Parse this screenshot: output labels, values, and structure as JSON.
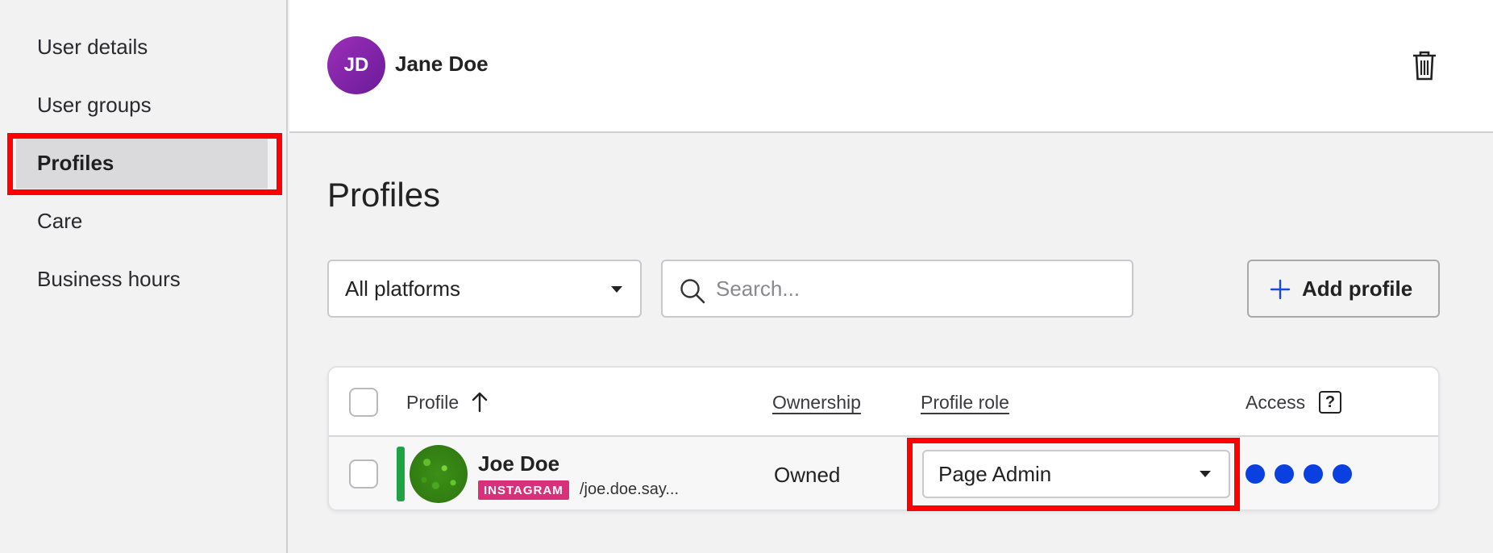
{
  "sidebar": {
    "items": [
      {
        "label": "User details"
      },
      {
        "label": "User groups"
      },
      {
        "label": "Profiles",
        "active": true
      },
      {
        "label": "Care"
      },
      {
        "label": "Business hours"
      }
    ]
  },
  "header": {
    "avatar_initials": "JD",
    "user_name": "Jane Doe",
    "delete_icon": "trash-icon"
  },
  "main": {
    "title": "Profiles",
    "platform_filter": {
      "selected": "All platforms"
    },
    "search": {
      "placeholder": "Search...",
      "value": ""
    },
    "add_button": {
      "label": "Add profile"
    },
    "table": {
      "columns": {
        "profile": "Profile",
        "ownership": "Ownership",
        "role": "Profile role",
        "access": "Access",
        "access_help": "?"
      },
      "rows": [
        {
          "name": "Joe Doe",
          "platform": "INSTAGRAM",
          "handle": "/joe.doe.say...",
          "ownership": "Owned",
          "role": "Page Admin",
          "access_level_count": 4
        }
      ]
    }
  },
  "colors": {
    "highlight": "#ff0000",
    "avatar": "#7b1fa2",
    "instagram_badge": "#d8317a",
    "status_active": "#1fa345",
    "access_dot": "#0a3fe0"
  }
}
